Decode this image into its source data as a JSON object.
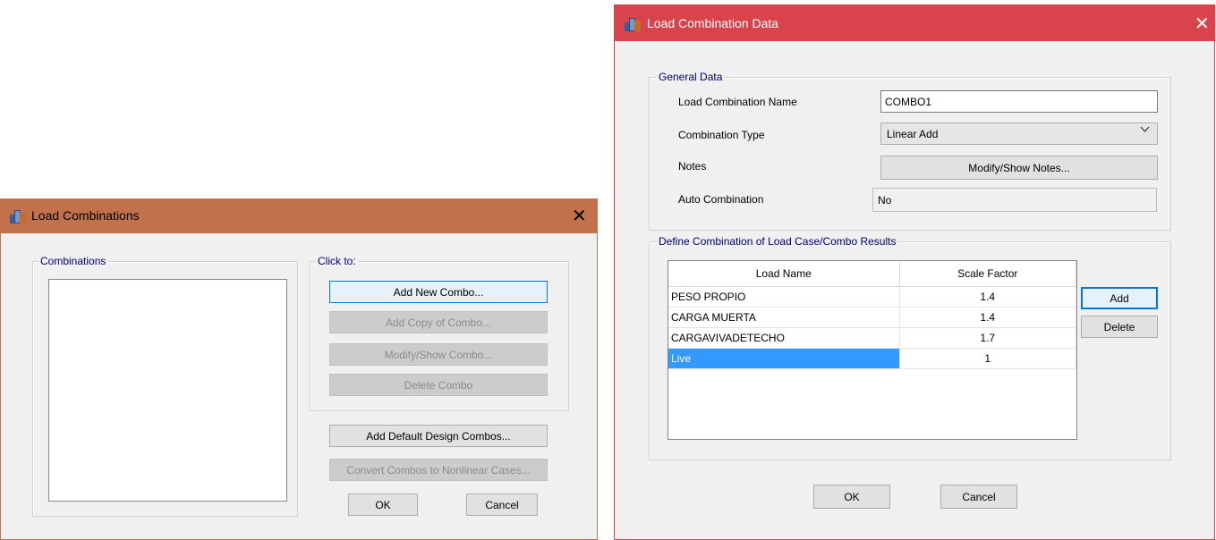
{
  "load_combinations": {
    "title": "Load Combinations",
    "title_color": "#c1724a",
    "close_glyph": "✕",
    "combinations_group": {
      "label": "Combinations",
      "items": []
    },
    "click_to_group": {
      "label": "Click to:",
      "add_new": "Add New Combo...",
      "add_copy": "Add Copy of Combo...",
      "modify_show": "Modify/Show Combo...",
      "delete": "Delete Combo"
    },
    "add_default_design": "Add Default Design Combos...",
    "convert_nonlinear": "Convert Combos to Nonlinear Cases...",
    "ok": "OK",
    "cancel": "Cancel"
  },
  "combo_data": {
    "title": "Load Combination Data",
    "title_color": "#d9434b",
    "close_glyph": "✕",
    "general": {
      "label": "General Data",
      "name_label": "Load Combination Name",
      "name_value": "COMBO1",
      "type_label": "Combination Type",
      "type_value": "Linear Add",
      "notes_label": "Notes",
      "notes_button": "Modify/Show Notes...",
      "auto_label": "Auto Combination",
      "auto_value": "No"
    },
    "define": {
      "label": "Define Combination of Load Case/Combo Results",
      "columns": [
        "Load Name",
        "Scale Factor"
      ],
      "rows": [
        {
          "name": "PESO PROPIO",
          "factor": "1.4"
        },
        {
          "name": "CARGA MUERTA",
          "factor": "1.4"
        },
        {
          "name": "CARGAVIVADETECHO",
          "factor": "1.7"
        },
        {
          "name": "Live",
          "factor": "1"
        }
      ],
      "selected_row": 3,
      "add": "Add",
      "delete": "Delete"
    },
    "ok": "OK",
    "cancel": "Cancel"
  }
}
